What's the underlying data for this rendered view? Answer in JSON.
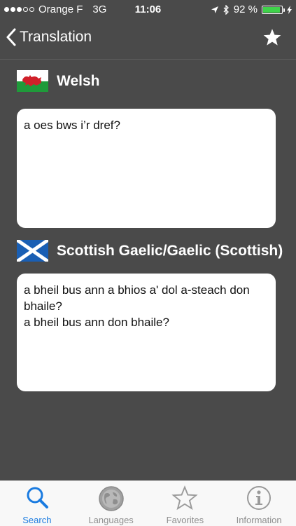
{
  "status": {
    "carrier": "Orange F",
    "network": "3G",
    "time": "11:06",
    "battery_pct": "92 %",
    "battery_level": 0.92
  },
  "nav": {
    "back_label": "Translation",
    "favorite_icon": "star-icon"
  },
  "source": {
    "language": "Welsh",
    "flag": "wales-flag",
    "text": "a oes bws i’r dref?"
  },
  "target": {
    "language": "Scottish Gaelic/Gaelic (Scottish)",
    "flag": "scotland-flag",
    "text": "a bheil bus ann a bhios a' dol a-steach don bhaile?\na bheil bus ann don bhaile?"
  },
  "tabs": [
    {
      "label": "Search",
      "icon": "search-icon",
      "active": true
    },
    {
      "label": "Languages",
      "icon": "globe-icon",
      "active": false
    },
    {
      "label": "Favorites",
      "icon": "star-icon",
      "active": false
    },
    {
      "label": "Information",
      "icon": "info-icon",
      "active": false
    }
  ],
  "colors": {
    "background": "#4a4a4a",
    "accent": "#1a7be0",
    "battery": "#3fd34a"
  }
}
